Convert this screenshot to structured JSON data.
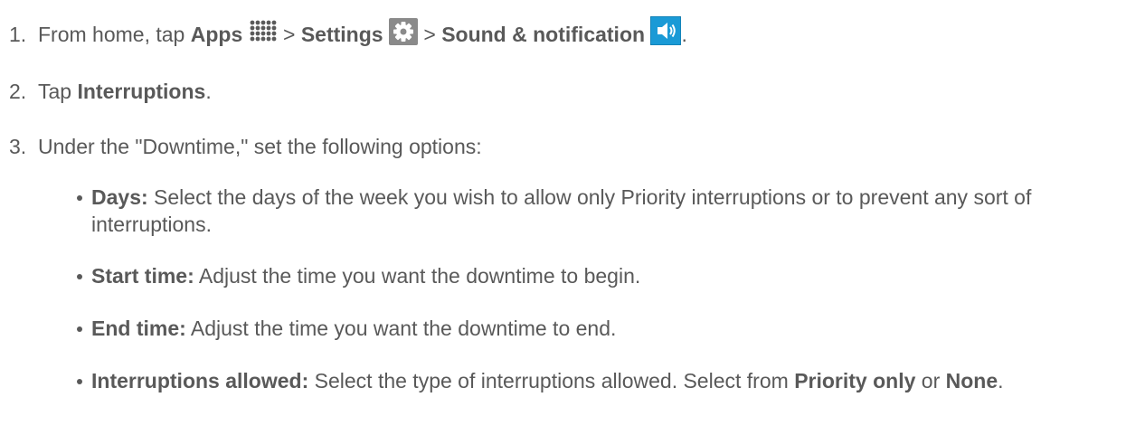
{
  "steps": [
    {
      "num": "1.",
      "t1": "From home, tap ",
      "apps": "Apps",
      "sep1": " > ",
      "settings": "Settings",
      "sep2": " > ",
      "sound": "Sound & notification",
      "end": "."
    },
    {
      "num": "2.",
      "t1": "Tap ",
      "b1": "Interruptions",
      "end": "."
    },
    {
      "num": "3.",
      "t1": "Under the \"Downtime,\" set the following options:"
    }
  ],
  "bullets": [
    {
      "label": "Days:",
      "text": " Select the days of the week you wish to allow only Priority interruptions or to prevent any sort of interruptions."
    },
    {
      "label": "Start time:",
      "text": " Adjust the time you want the downtime to begin."
    },
    {
      "label": "End time:",
      "text": " Adjust the time you want the downtime to end."
    },
    {
      "label": "Interruptions allowed:",
      "text": " Select the type of interruptions allowed. Select from ",
      "b2": "Priority only",
      "text2": " or ",
      "b3": "None",
      "end": "."
    }
  ],
  "icons": {
    "apps": "apps-grid-icon",
    "settings": "settings-gear-icon",
    "sound": "speaker-sound-icon",
    "sound_bg": "#1a9ad6",
    "settings_bg": "#8a8a8a"
  }
}
